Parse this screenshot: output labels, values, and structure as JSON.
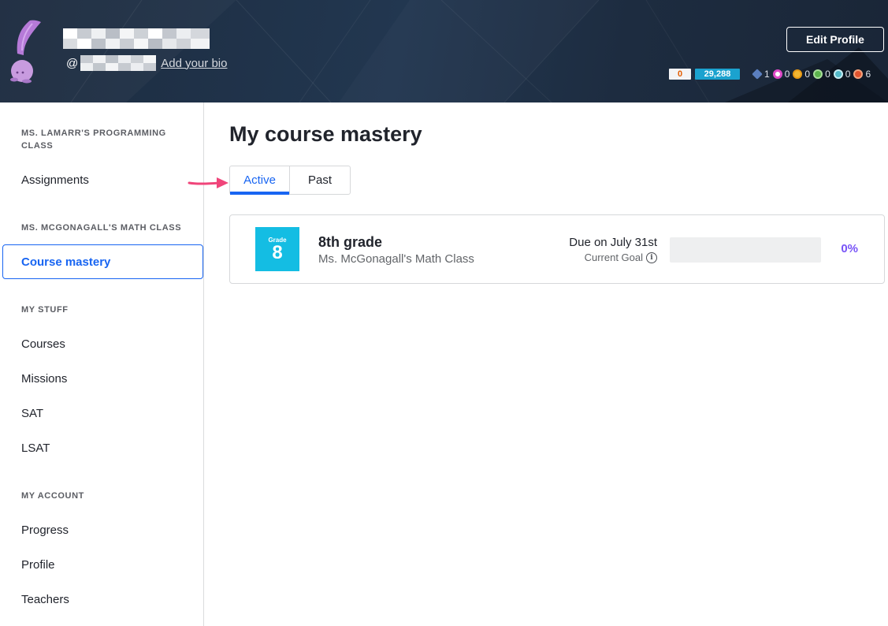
{
  "header": {
    "handle_prefix": "@",
    "bio_link": "Add your bio",
    "edit_profile_label": "Edit Profile",
    "streak": "0",
    "points": "29,288",
    "badges": [
      {
        "icon": "meteorite-badge-icon",
        "color": "#5b7fbf",
        "count": "1"
      },
      {
        "icon": "moon-badge-icon",
        "color": "#e04ac8",
        "count": "0"
      },
      {
        "icon": "earth-badge-icon",
        "color": "#f2b632",
        "count": "0"
      },
      {
        "icon": "sun-badge-icon",
        "color": "#5bb34d",
        "count": "0"
      },
      {
        "icon": "black-hole-badge-icon",
        "color": "#53b9c9",
        "count": "0"
      },
      {
        "icon": "challenge-patch-icon",
        "color": "#e0532e",
        "count": "6"
      }
    ]
  },
  "sidebar": {
    "sections": [
      {
        "title": "MS. LAMARR'S PROGRAMMING CLASS",
        "items": [
          "Assignments"
        ]
      },
      {
        "title": "MS. MCGONAGALL'S MATH CLASS",
        "items": [
          "Course mastery"
        ]
      },
      {
        "title": "MY STUFF",
        "items": [
          "Courses",
          "Missions",
          "SAT",
          "LSAT"
        ]
      },
      {
        "title": "MY ACCOUNT",
        "items": [
          "Progress",
          "Profile",
          "Teachers"
        ]
      }
    ]
  },
  "main": {
    "title": "My course mastery",
    "tabs": {
      "active": "Active",
      "past": "Past"
    },
    "course": {
      "grade_label": "Grade",
      "grade_number": "8",
      "name": "8th grade",
      "class_name": "Ms. McGonagall's Math Class",
      "due": "Due on July 31st",
      "goal_label": "Current Goal",
      "progress": 0,
      "progress_text": "0%"
    }
  },
  "colors": {
    "accent": "#1865f2",
    "mastery_purple": "#7854f7",
    "grade_icon": "#14bde3",
    "arrow": "#f0457a"
  }
}
